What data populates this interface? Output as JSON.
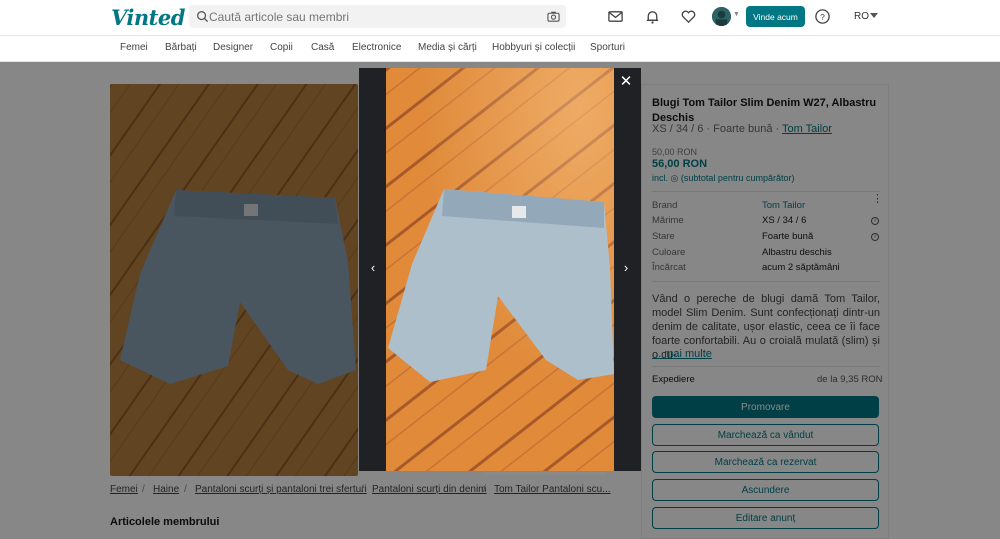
{
  "header": {
    "logo": "Vinted",
    "search_placeholder": "Caută articole sau membri",
    "sell_label": "Vinde acum",
    "language": "RO",
    "icons": [
      "mail-icon",
      "bell-icon",
      "heart-icon",
      "avatar",
      "help-icon"
    ]
  },
  "categories": [
    "Femei",
    "Bărbați",
    "Designer",
    "Copii",
    "Casă",
    "Electronice",
    "Media și cărți",
    "Hobbyuri și colecții",
    "Sporturi"
  ],
  "item": {
    "title": "Blugi Tom Tailor Slim Denim W27, Albastru Deschis",
    "subtitle": "XS / 34 / 6 · Foarte bună ·",
    "brand_link": "Tom Tailor",
    "price_old": "50,00 RON",
    "price_new": "56,00 RON",
    "price_incl": "incl.",
    "price_incl_note": "(subtotal pentru cumpărător)",
    "details": [
      {
        "label": "Brand",
        "value": "Tom Tailor"
      },
      {
        "label": "Mărime",
        "value": "XS / 34 / 6"
      },
      {
        "label": "Stare",
        "value": "Foarte bună"
      },
      {
        "label": "Culoare",
        "value": "Albastru deschis"
      },
      {
        "label": "Încărcat",
        "value": "acum 2 săptămâni"
      }
    ],
    "description": "Vând o pereche de blugi damă Tom Tailor, model Slim Denim. Sunt confecționați dintr-un denim de calitate, ușor elastic, ceea ce îi face foarte confortabili. Au o croială mulată (slim) și o cu-",
    "more": "... mai multe",
    "shipping_label": "Expediere",
    "shipping_value": "de la 9,35 RON"
  },
  "actions": [
    "Promovare",
    "Marchează ca vândut",
    "Marchează ca rezervat",
    "Ascundere",
    "Editare anunț"
  ],
  "breadcrumb": [
    "Femei",
    "Haine",
    "Pantaloni scurți și pantaloni trei sferturi",
    "Pantaloni scurți din denim",
    "Tom Tailor Pantaloni scu..."
  ],
  "member_items_title": "Articolele membrului",
  "modal": {
    "close_glyph": "✕",
    "prev_glyph": "‹",
    "next_glyph": "›"
  },
  "colors": {
    "accent": "#007782",
    "overlay": "rgba(0,0,0,0.47)",
    "modal_bg": "#1f2124"
  }
}
